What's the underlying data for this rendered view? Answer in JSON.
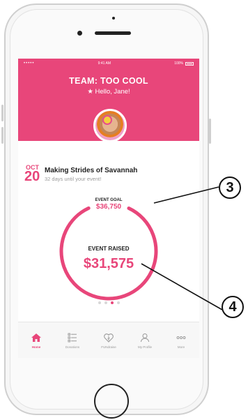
{
  "status_bar": {
    "carrier": "•••••",
    "time": "9:41 AM",
    "battery": "100%"
  },
  "header": {
    "team": "TEAM: TOO COOL",
    "greeting": "★ Hello, Jane!"
  },
  "event": {
    "month": "OCT",
    "day": "20",
    "name": "Making Strides of Savannah",
    "days_until": "32 days until your event!"
  },
  "goal": {
    "label": "EVENT GOAL",
    "value": "$36,750"
  },
  "raised": {
    "label": "EVENT RAISED",
    "value": "$31,575",
    "progress": 0.86
  },
  "pager": {
    "count": 4,
    "active_index": 2
  },
  "tabs": [
    {
      "label": "Home",
      "icon": "home-icon",
      "active": true
    },
    {
      "label": "Donations",
      "icon": "list-icon",
      "active": false
    },
    {
      "label": "FUNdraise",
      "icon": "heart-icon",
      "active": false
    },
    {
      "label": "My Profile",
      "icon": "profile-icon",
      "active": false
    },
    {
      "label": "More",
      "icon": "more-icon",
      "active": false
    }
  ],
  "callouts": [
    "3",
    "4"
  ],
  "colors": {
    "accent": "#e8467a",
    "ring_track": "#d9d9d9"
  }
}
